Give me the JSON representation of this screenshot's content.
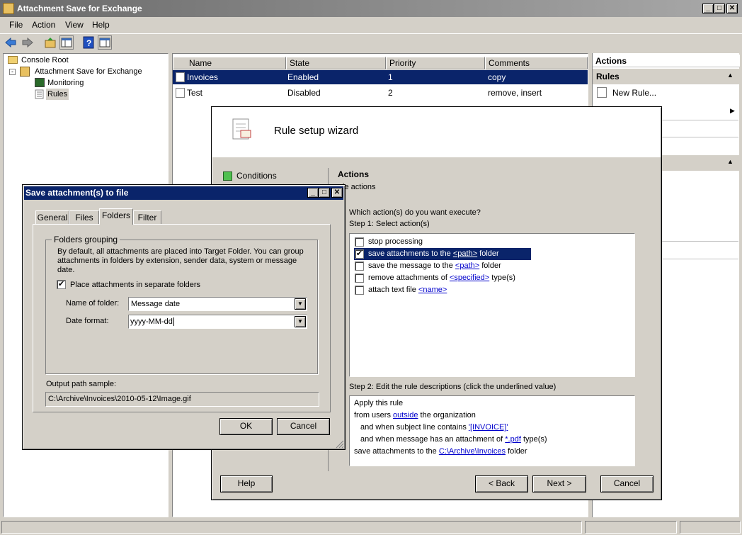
{
  "window": {
    "title": "Attachment Save for Exchange",
    "btn_min": "_",
    "btn_max": "□",
    "btn_close": "✕"
  },
  "menu": [
    "File",
    "Action",
    "View",
    "Help"
  ],
  "tree": {
    "root": "Console Root",
    "app": "Attachment Save for Exchange",
    "monitoring": "Monitoring",
    "rules": "Rules"
  },
  "list": {
    "columns": [
      "Name",
      "State",
      "Priority",
      "Comments"
    ],
    "rows": [
      {
        "name": "Invoices",
        "state": "Enabled",
        "priority": "1",
        "comments": "copy"
      },
      {
        "name": "Test",
        "state": "Disabled",
        "priority": "2",
        "comments": "remove, insert"
      }
    ]
  },
  "actions_pane": {
    "header": "Actions",
    "section": "Rules",
    "new_rule": "New Rule..."
  },
  "wizard": {
    "title": "Rule setup wizard",
    "nav_conditions": "Conditions",
    "section_title": "Actions",
    "section_sub": "le actions",
    "question": "Which action(s) do you want execute?",
    "step1": "Step 1: Select action(s)",
    "actions": [
      {
        "pre": "stop processing",
        "link": "",
        "post": "",
        "checked": false,
        "selected": false
      },
      {
        "pre": "save attachments to the ",
        "link": "<path>",
        "post": " folder",
        "checked": true,
        "selected": true
      },
      {
        "pre": "save the message to the ",
        "link": "<path>",
        "post": " folder",
        "checked": false,
        "selected": false
      },
      {
        "pre": "remove attachments of ",
        "link": "<specified>",
        "post": " type(s)",
        "checked": false,
        "selected": false
      },
      {
        "pre": "attach text file ",
        "link": "<name>",
        "post": "",
        "checked": false,
        "selected": false
      }
    ],
    "step2": "Step 2: Edit the rule descriptions (click the underlined value)",
    "desc": {
      "l1": "Apply this rule",
      "l2_pre": "from users ",
      "l2_link": "outside",
      "l2_post": " the organization",
      "l3_pre": "and when subject line contains ",
      "l3_link": "'[INVOICE]'",
      "l4_pre": "and when message has an attachment of ",
      "l4_link": "*.pdf",
      "l4_post": " type(s)",
      "l5_pre": "save attachments to the ",
      "l5_link": "C:\\Archive\\Invoices",
      "l5_post": " folder"
    },
    "btn_help": "Help",
    "btn_back": "< Back",
    "btn_next": "Next >",
    "btn_cancel": "Cancel"
  },
  "dialog": {
    "title": "Save attachment(s) to file",
    "tabs": [
      "General",
      "Files",
      "Folders",
      "Filter"
    ],
    "group_title": "Folders grouping",
    "description": "By default, all attachments are placed into Target Folder. You can group attachments in folders by extension, sender data, system or message date.",
    "checkbox_label": "Place attachments in separate folders",
    "checkbox_checked": true,
    "name_label": "Name of folder:",
    "name_value": "Message date",
    "date_label": "Date format:",
    "date_value": "yyyy-MM-dd",
    "output_label": "Output path sample:",
    "output_value": "C:\\Archive\\Invoices\\2010-05-12\\Image.gif",
    "btn_ok": "OK",
    "btn_cancel": "Cancel"
  }
}
